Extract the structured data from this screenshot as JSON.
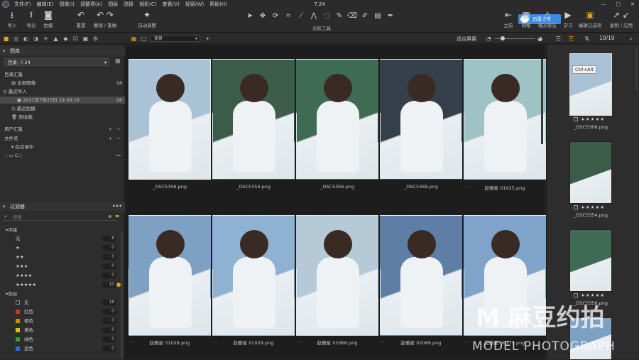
{
  "menubar": {
    "items": [
      "文件(F)",
      "编辑(E)",
      "图像(I)",
      "调整项(A)",
      "图层",
      "选择",
      "相机(C)",
      "查看(V)",
      "视窗(W)",
      "帮助(H)"
    ],
    "title": "7.24",
    "controls": [
      "—",
      "□",
      "✕"
    ]
  },
  "toolbar": {
    "import": "导入",
    "export": "导出",
    "capture": "拍摄",
    "reset": "重置",
    "undo_redo": "撤销 / 重做",
    "auto_adjust": "自动调整",
    "cursor_tools": "光标工具",
    "cloud_badge": "迅雷上传",
    "previous": "之前",
    "grid": "网格",
    "exposure_warning": "曝光警告",
    "learn": "学习",
    "edit_selected": "编辑已选项",
    "copy_apply": "复制 / 应用"
  },
  "subbar": {
    "view_select": "背景",
    "fit_label": "适合屏幕",
    "count": "10/10"
  },
  "library": {
    "header": "图库",
    "catalog": "目录: 7.24",
    "catalog_collections": "目录汇集",
    "all_images": "全部图像",
    "all_images_count": "18",
    "recent_imports": "最近导入",
    "recent_import_item": "2021年7月25日 19:30:16",
    "recent_import_count": "18",
    "recent_captures": "最近拍摄",
    "trash": "回收箱",
    "user_collections": "用户汇集",
    "folders": "文件夹",
    "in_catalog": "在目录中",
    "drive": "C:\\"
  },
  "filters": {
    "header": "过滤器",
    "search_placeholder": "搜索",
    "rating_header": "评级",
    "ratings": [
      {
        "label": "无",
        "count": "8"
      },
      {
        "label": "★",
        "count": "0"
      },
      {
        "label": "★★",
        "count": "0"
      },
      {
        "label": "★★★",
        "count": "0"
      },
      {
        "label": "★★★★",
        "count": "0"
      },
      {
        "label": "★★★★★",
        "count": "10"
      }
    ],
    "color_header": "色标",
    "colors": [
      {
        "label": "无",
        "count": "18",
        "color": "#2d2d2d"
      },
      {
        "label": "红色",
        "count": "0",
        "color": "#c0392b"
      },
      {
        "label": "橙色",
        "count": "0",
        "color": "#d68910"
      },
      {
        "label": "黄色",
        "count": "0",
        "color": "#d4c21a"
      },
      {
        "label": "绿色",
        "count": "0",
        "color": "#3c9a3c"
      },
      {
        "label": "蓝色",
        "count": "0",
        "color": "#2e6fc9"
      }
    ]
  },
  "grid": {
    "items": [
      {
        "name": "_DSC5306.png",
        "tone": "#a9c2d6"
      },
      {
        "name": "_DSC5354.png",
        "tone": "#3c5c4a"
      },
      {
        "name": "_DSC5356.png",
        "tone": "#3f6a53"
      },
      {
        "name": "_DSC5369.png",
        "tone": "#35404a"
      },
      {
        "name": "赵雅星 01025.png",
        "tone": "#9fc2c4"
      },
      {
        "name": "赵雅星 01028.png",
        "tone": "#7ea0c2"
      },
      {
        "name": "赵雅星 01029.png",
        "tone": "#8fb1d2"
      },
      {
        "name": "赵雅星 02066.png",
        "tone": "#b6c9d7"
      },
      {
        "name": "赵雅星 02069.png",
        "tone": "#5e7ea6"
      },
      {
        "name": "赵雅星 06175.png",
        "tone": "#7fa3c9"
      }
    ],
    "dash": "--"
  },
  "filmstrip": {
    "tooltip": "Ctrl+Alt",
    "items": [
      {
        "name": "_DSC5306.png",
        "stars": "★★★★★",
        "tone": "#a9c2d6"
      },
      {
        "name": "_DSC5354.png",
        "stars": "★★★★★",
        "tone": "#3c5c4a"
      },
      {
        "name": "_DSC5356.png",
        "stars": "★★★★★",
        "tone": "#3f6a53"
      },
      {
        "name": "",
        "stars": "",
        "tone": "#7ea0c2"
      }
    ]
  },
  "watermark": {
    "brand": "M 麻豆约拍",
    "sub": "MODEL PHOTOGRAPH"
  }
}
